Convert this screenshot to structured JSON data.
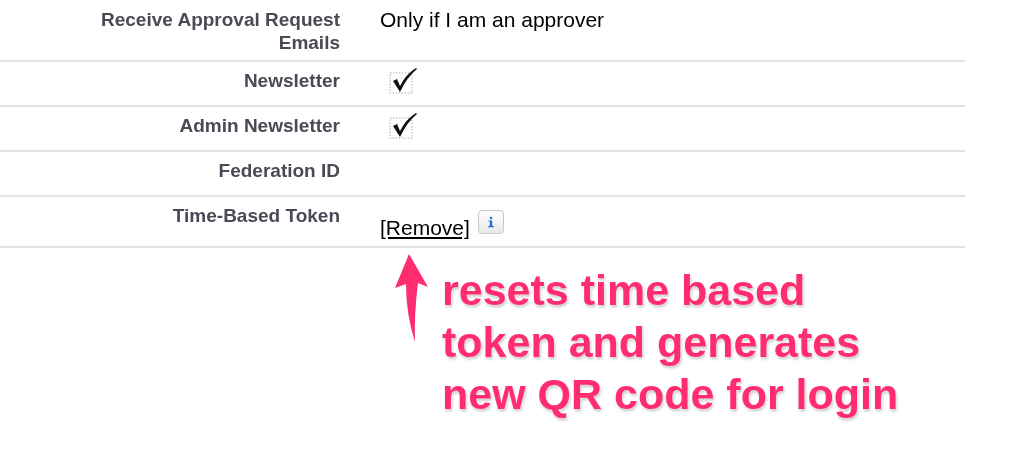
{
  "rows": [
    {
      "label": "Receive Approval Request Emails",
      "kind": "text",
      "value": "Only if I am an approver"
    },
    {
      "label": "Newsletter",
      "kind": "checkbox",
      "checked": true
    },
    {
      "label": "Admin Newsletter",
      "kind": "checkbox",
      "checked": true
    },
    {
      "label": "Federation ID",
      "kind": "empty"
    },
    {
      "label": "Time-Based Token",
      "kind": "link",
      "value": "[Remove]",
      "info": true
    }
  ],
  "annotation": {
    "text": "resets time based\ntoken and generates\nnew QR code for login"
  }
}
